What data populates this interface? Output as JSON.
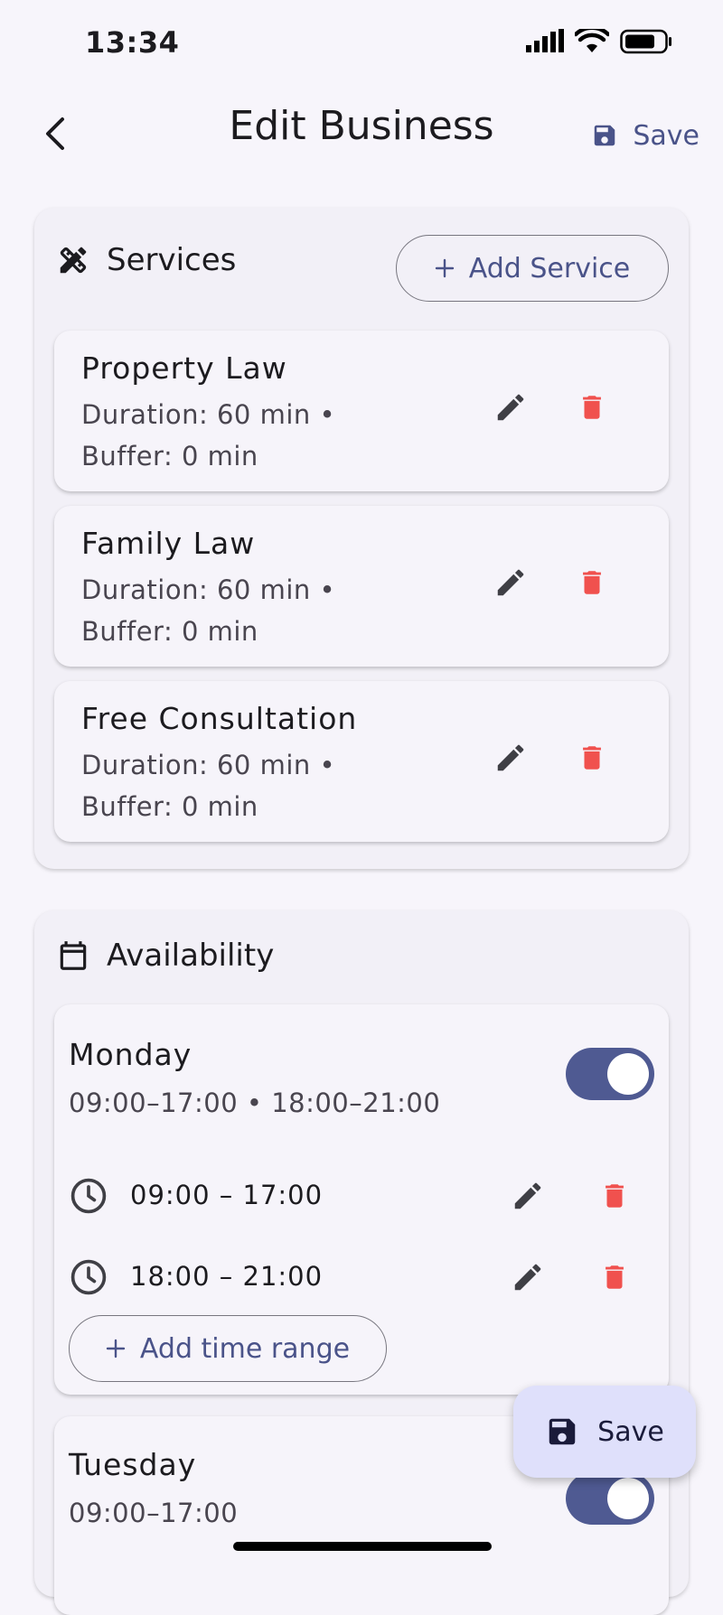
{
  "status_bar": {
    "time": "13:34"
  },
  "app_bar": {
    "title": "Edit Business",
    "save_label": "Save"
  },
  "services": {
    "heading": "Services",
    "add_label": "Add Service",
    "items": [
      {
        "name": "Property Law",
        "duration": "Duration: 60 min •",
        "buffer": "Buffer: 0 min"
      },
      {
        "name": "Family Law",
        "duration": "Duration: 60 min •",
        "buffer": "Buffer: 0 min"
      },
      {
        "name": "Free Consultation",
        "duration": "Duration: 60 min •",
        "buffer": "Buffer: 0 min"
      }
    ]
  },
  "availability": {
    "heading": "Availability",
    "days": [
      {
        "name": "Monday",
        "summary": "09:00–17:00 • 18:00–21:00",
        "enabled": true,
        "ranges": [
          "09:00 – 17:00",
          "18:00 – 21:00"
        ],
        "add_range_label": "Add time range"
      },
      {
        "name": "Tuesday",
        "summary": "09:00–17:00",
        "enabled": true
      }
    ]
  },
  "fab": {
    "label": "Save"
  },
  "colors": {
    "accent": "#4a5389",
    "delete": "#f0514e",
    "toggle_on": "#4f5a92",
    "fab_bg": "#dfe0fb"
  }
}
